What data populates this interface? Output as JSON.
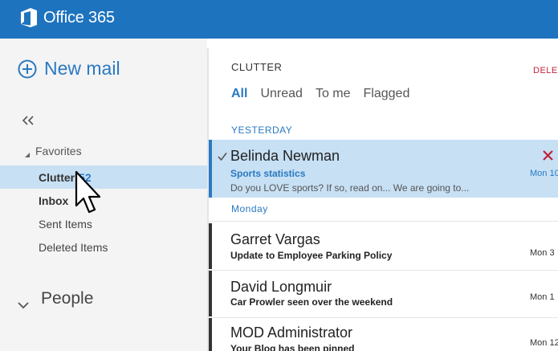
{
  "app": {
    "title": "Office 365"
  },
  "leftpane": {
    "new_mail_label": "New mail",
    "favorites_label": "Favorites",
    "folders": [
      {
        "name": "Clutter",
        "count": "52",
        "selected": true
      },
      {
        "name": "Inbox",
        "count": "",
        "selected": false
      },
      {
        "name": "Sent Items",
        "count": "",
        "selected": false
      },
      {
        "name": "Deleted Items",
        "count": "",
        "selected": false
      }
    ],
    "people_label": "People"
  },
  "mainpane": {
    "folder_title": "CLUTTER",
    "delete_label": "DELETE",
    "filters": [
      "All",
      "Unread",
      "To me",
      "Flagged"
    ],
    "active_filter": "All",
    "groups": [
      "YESTERDAY",
      "Monday"
    ],
    "messages": [
      {
        "sender": "Belinda Newman",
        "subject": "Sports statistics",
        "preview": "Do you LOVE sports? If so, read on... We are going to...",
        "date": "Mon 10",
        "selected": true
      },
      {
        "sender": "Garret Vargas",
        "subject": "Update to Employee Parking Policy",
        "preview": "",
        "date": "Mon 3",
        "selected": false
      },
      {
        "sender": "David Longmuir",
        "subject": "Car Prowler seen over the weekend",
        "preview": "",
        "date": "Mon 1",
        "selected": false
      },
      {
        "sender": "MOD Administrator",
        "subject": "Your Blog has been pinned",
        "preview": "",
        "date": "Mon 12",
        "selected": false
      }
    ]
  },
  "colors": {
    "brand": "#1e73be",
    "accent": "#2a79c2",
    "selection": "#c7e0f4",
    "delete": "#c0223a"
  },
  "icons": [
    "office-logo-icon",
    "new-mail-plus-icon",
    "collapse-double-chevron-icon",
    "caret-down-icon",
    "chevron-down-icon",
    "checkmark-icon",
    "delete-x-icon",
    "mouse-pointer-icon"
  ]
}
